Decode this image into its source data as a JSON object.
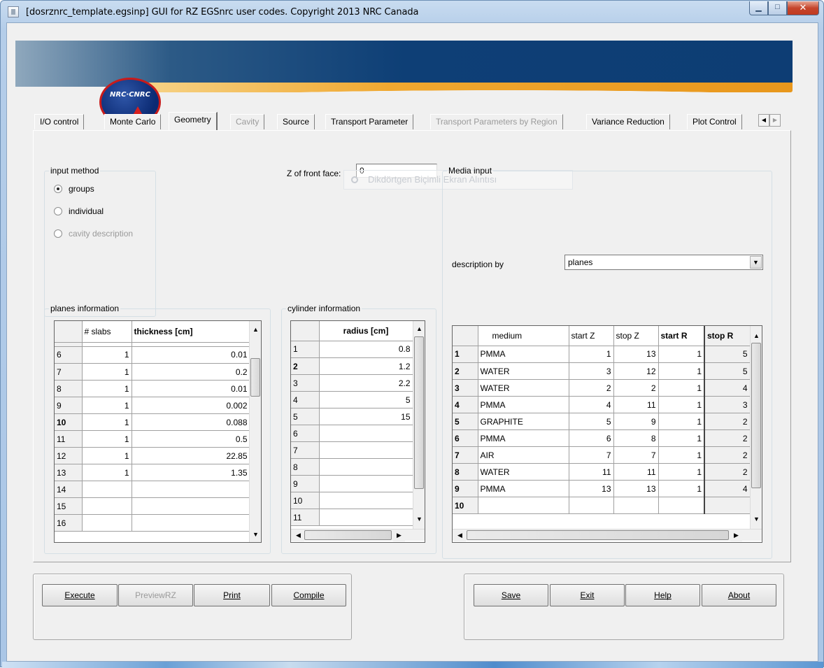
{
  "window": {
    "title": "[dosrznrc_template.egsinp] GUI for RZ EGSnrc user codes. Copyright 2013 NRC Canada",
    "minimize_glyph": "▁",
    "maximize_glyph": "□",
    "close_glyph": "✕"
  },
  "banner": {
    "logo_text": "NRC·CNRC"
  },
  "tabs": [
    {
      "label": "I/O control",
      "state": "normal"
    },
    {
      "label": "Monte Carlo",
      "state": "normal"
    },
    {
      "label": "Geometry",
      "state": "active"
    },
    {
      "label": "Cavity",
      "state": "disabled"
    },
    {
      "label": "Source",
      "state": "normal"
    },
    {
      "label": "Transport Parameter",
      "state": "normal"
    },
    {
      "label": "Transport Parameters by Region",
      "state": "disabled"
    },
    {
      "label": "Variance Reduction",
      "state": "normal"
    },
    {
      "label": "Plot Control",
      "state": "normal"
    }
  ],
  "tab_scroll": {
    "left": "◀",
    "right": "▶"
  },
  "input_method": {
    "legend": "input method",
    "options": [
      {
        "label": "groups",
        "checked": true,
        "enabled": true
      },
      {
        "label": "individual",
        "checked": false,
        "enabled": true
      },
      {
        "label": "cavity description",
        "checked": false,
        "enabled": false
      }
    ]
  },
  "front_face": {
    "label": "Z of front face:",
    "value": "0"
  },
  "ghost_tooltip": "Dikdörtgen Biçimli Ekran Alıntısı",
  "media_input": {
    "legend": "Media input",
    "description_label": "description by",
    "description_value": "planes"
  },
  "planes": {
    "legend": "planes information",
    "columns": [
      "",
      "# slabs",
      "thickness [cm]"
    ],
    "rows": [
      {
        "row": "6",
        "slabs": "1",
        "thickness": "0.01"
      },
      {
        "row": "7",
        "slabs": "1",
        "thickness": "0.2"
      },
      {
        "row": "8",
        "slabs": "1",
        "thickness": "0.01"
      },
      {
        "row": "9",
        "slabs": "1",
        "thickness": "0.002"
      },
      {
        "row": "10",
        "slabs": "1",
        "thickness": "0.088"
      },
      {
        "row": "11",
        "slabs": "1",
        "thickness": "0.5"
      },
      {
        "row": "12",
        "slabs": "1",
        "thickness": "22.85"
      },
      {
        "row": "13",
        "slabs": "1",
        "thickness": "1.35"
      },
      {
        "row": "14",
        "slabs": "",
        "thickness": ""
      },
      {
        "row": "15",
        "slabs": "",
        "thickness": ""
      },
      {
        "row": "16",
        "slabs": "",
        "thickness": ""
      }
    ]
  },
  "cylinders": {
    "legend": "cylinder information",
    "columns": [
      "",
      "radius [cm]"
    ],
    "rows": [
      {
        "row": "1",
        "radius": "0.8"
      },
      {
        "row": "2",
        "radius": "1.2"
      },
      {
        "row": "3",
        "radius": "2.2"
      },
      {
        "row": "4",
        "radius": "5"
      },
      {
        "row": "5",
        "radius": "15"
      },
      {
        "row": "6",
        "radius": ""
      },
      {
        "row": "7",
        "radius": ""
      },
      {
        "row": "8",
        "radius": ""
      },
      {
        "row": "9",
        "radius": ""
      },
      {
        "row": "10",
        "radius": ""
      },
      {
        "row": "11",
        "radius": ""
      }
    ]
  },
  "media": {
    "columns": [
      "",
      "medium",
      "start Z",
      "stop Z",
      "start R",
      "stop R"
    ],
    "rows": [
      {
        "row": "1",
        "medium": "PMMA",
        "startZ": "1",
        "stopZ": "13",
        "startR": "1",
        "stopR": "5"
      },
      {
        "row": "2",
        "medium": "WATER",
        "startZ": "3",
        "stopZ": "12",
        "startR": "1",
        "stopR": "5"
      },
      {
        "row": "3",
        "medium": "WATER",
        "startZ": "2",
        "stopZ": "2",
        "startR": "1",
        "stopR": "4"
      },
      {
        "row": "4",
        "medium": "PMMA",
        "startZ": "4",
        "stopZ": "11",
        "startR": "1",
        "stopR": "3"
      },
      {
        "row": "5",
        "medium": "GRAPHITE",
        "startZ": "5",
        "stopZ": "9",
        "startR": "1",
        "stopR": "2"
      },
      {
        "row": "6",
        "medium": "PMMA",
        "startZ": "6",
        "stopZ": "8",
        "startR": "1",
        "stopR": "2"
      },
      {
        "row": "7",
        "medium": "AIR",
        "startZ": "7",
        "stopZ": "7",
        "startR": "1",
        "stopR": "2"
      },
      {
        "row": "8",
        "medium": "WATER",
        "startZ": "11",
        "stopZ": "11",
        "startR": "1",
        "stopR": "2"
      },
      {
        "row": "9",
        "medium": "PMMA",
        "startZ": "13",
        "stopZ": "13",
        "startR": "1",
        "stopR": "4"
      },
      {
        "row": "10",
        "medium": "",
        "startZ": "",
        "stopZ": "",
        "startR": "",
        "stopR": ""
      }
    ]
  },
  "scroll_glyphs": {
    "up": "▲",
    "down": "▼",
    "left": "◀",
    "right": "▶",
    "drop": "▼"
  },
  "buttons_left": [
    {
      "label": "Execute",
      "enabled": true
    },
    {
      "label": "PreviewRZ",
      "enabled": false
    },
    {
      "label": "Print",
      "enabled": true
    },
    {
      "label": "Compile",
      "enabled": true
    }
  ],
  "buttons_right": [
    {
      "label": "Save",
      "enabled": true
    },
    {
      "label": "Exit",
      "enabled": true
    },
    {
      "label": "Help",
      "enabled": true
    },
    {
      "label": "About",
      "enabled": true
    }
  ]
}
